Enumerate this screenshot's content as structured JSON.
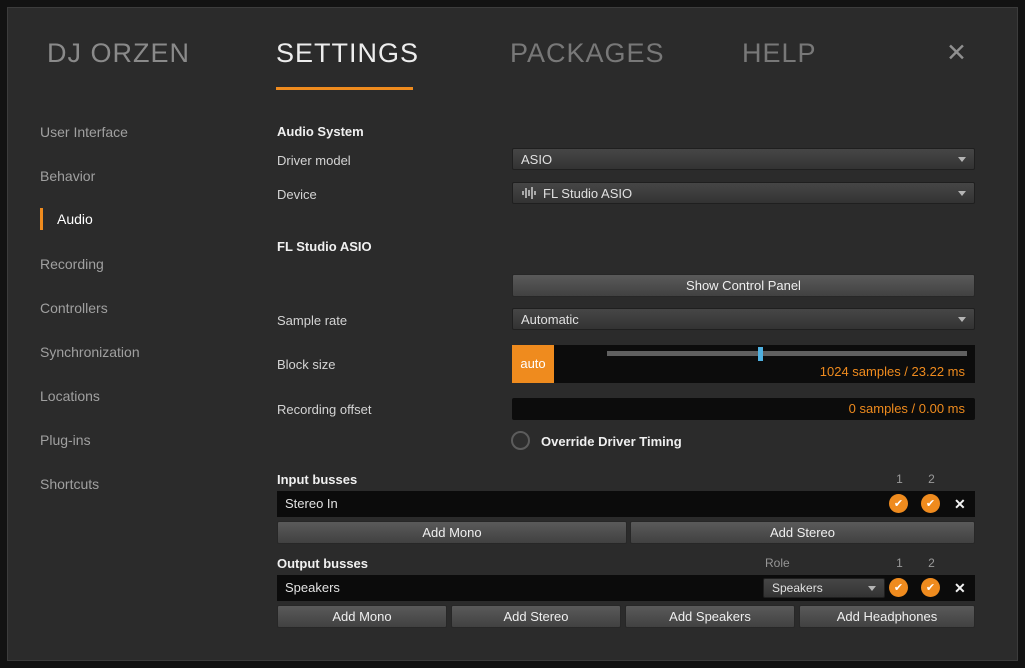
{
  "header": {
    "brand": "DJ ORZEN",
    "tabs": [
      {
        "label": "SETTINGS",
        "active": true
      },
      {
        "label": "PACKAGES",
        "active": false
      },
      {
        "label": "HELP",
        "active": false
      }
    ]
  },
  "icons": {
    "close": "✕",
    "check": "✔",
    "delete": "✕"
  },
  "sidebar": {
    "items": [
      {
        "label": "User Interface",
        "active": false
      },
      {
        "label": "Behavior",
        "active": false
      },
      {
        "label": "Audio",
        "active": true
      },
      {
        "label": "Recording",
        "active": false
      },
      {
        "label": "Controllers",
        "active": false
      },
      {
        "label": "Synchronization",
        "active": false
      },
      {
        "label": "Locations",
        "active": false
      },
      {
        "label": "Plug-ins",
        "active": false
      },
      {
        "label": "Shortcuts",
        "active": false
      }
    ]
  },
  "main": {
    "audio_system": {
      "heading": "Audio System",
      "driver_label": "Driver model",
      "driver_value": "ASIO",
      "device_label": "Device",
      "device_value": "FL Studio ASIO"
    },
    "device": {
      "heading": "FL Studio ASIO",
      "control_panel": "Show Control Panel",
      "sample_rate_label": "Sample rate",
      "sample_rate_value": "Automatic",
      "block_label": "Block size",
      "auto": "auto",
      "block_value": "1024 samples / 23.22 ms",
      "offset_label": "Recording offset",
      "offset_value": "0 samples / 0.00 ms",
      "override": "Override Driver Timing"
    },
    "input": {
      "heading": "Input busses",
      "col1": "1",
      "col2": "2",
      "row_name": "Stereo In",
      "buttons": [
        "Add Mono",
        "Add Stereo"
      ]
    },
    "output": {
      "heading": "Output busses",
      "role_label": "Role",
      "col1": "1",
      "col2": "2",
      "row_name": "Speakers",
      "role_value": "Speakers",
      "buttons": [
        "Add Mono",
        "Add Stereo",
        "Add Speakers",
        "Add Headphones"
      ]
    }
  },
  "colors": {
    "accent": "#ef8b1e",
    "slider_handle": "#4fb0e0",
    "dialog_bg": "#2b2b2b",
    "field_bg": "#0c0c0c"
  }
}
